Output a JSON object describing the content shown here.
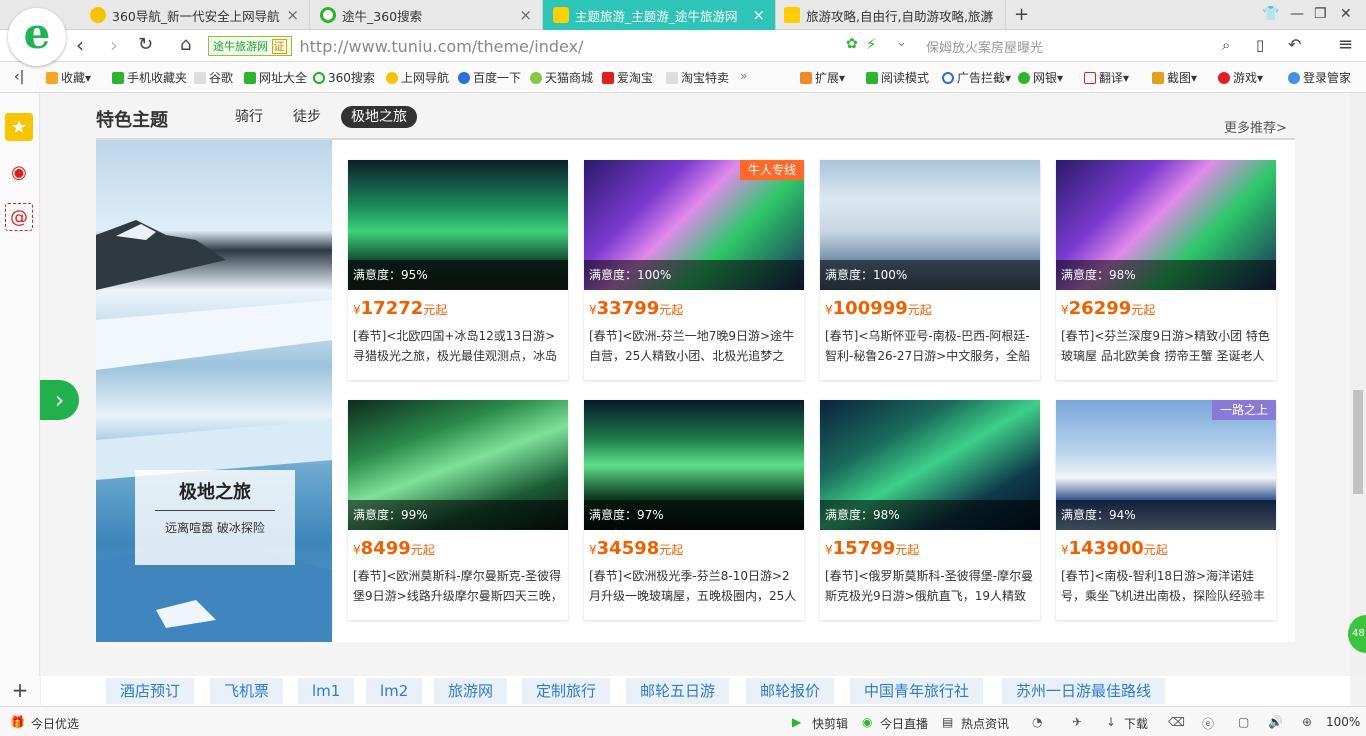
{
  "browser": {
    "tabs": [
      {
        "label": "360导航_新一代安全上网导航",
        "close": "×"
      },
      {
        "label": "途牛_360搜索",
        "close": "×"
      },
      {
        "label": "主题旅游_主题游_途牛旅游网",
        "close": "×"
      },
      {
        "label": "旅游攻略,自由行,自助游攻略,旅游",
        "close": "×"
      }
    ],
    "new_tab": "+",
    "site_badge": "途牛旅游网",
    "site_badge_verified": "证",
    "url": "http://www.tuniu.com/theme/index/",
    "search_placeholder": "保姆放火案房屋曝光",
    "logo_letter": "e"
  },
  "bookmarks": [
    {
      "label": "收藏",
      "color": "#f5a623"
    },
    {
      "label": "手机收藏夹",
      "color": "#2db52d"
    },
    {
      "label": "谷歌",
      "color": "#999999"
    },
    {
      "label": "网址大全",
      "color": "#2db52d"
    },
    {
      "label": "360搜索",
      "color": "#1bb21b"
    },
    {
      "label": "上网导航",
      "color": "#1bb21b"
    },
    {
      "label": "百度一下",
      "color": "#2b6de0"
    },
    {
      "label": "天猫商城",
      "color": "#8cc63f"
    },
    {
      "label": "爱淘宝",
      "color": "#e02020"
    },
    {
      "label": "淘宝特卖",
      "color": "#999999"
    }
  ],
  "bookmarks_more": "»",
  "toolbar_right": [
    {
      "label": "扩展"
    },
    {
      "label": "阅读模式"
    },
    {
      "label": "广告拦截"
    },
    {
      "label": "网银"
    },
    {
      "label": "翻译"
    },
    {
      "label": "截图"
    },
    {
      "label": "游戏"
    },
    {
      "label": "登录管家"
    }
  ],
  "section": {
    "title": "特色主题",
    "tabs": [
      "骑行",
      "徒步",
      "极地之旅"
    ],
    "active_tab": "极地之旅",
    "more": "更多推荐>"
  },
  "banner": {
    "title": "极地之旅",
    "subtitle": "远离喧嚣 破冰探险"
  },
  "products": [
    {
      "satisfaction": "满意度：95%",
      "currency": "¥",
      "price": "17272",
      "suffix": "元起",
      "desc": "[春节]<北欧四国+冰岛12或13日游>寻猎极光之旅，极光最佳观测点，冰岛双",
      "tag": ""
    },
    {
      "satisfaction": "满意度：100%",
      "currency": "¥",
      "price": "33799",
      "suffix": "元起",
      "desc": "[春节]<欧洲-芬兰一地7晚9日游>途牛自营，25人精致小团、北极光追梦之",
      "tag": "牛人专线"
    },
    {
      "satisfaction": "满意度：100%",
      "currency": "¥",
      "price": "100999",
      "suffix": "元起",
      "desc": "[春节]<乌斯怀亚号-南极-巴西-阿根廷-智利-秘鲁26-27日游>中文服务，全船",
      "tag": ""
    },
    {
      "satisfaction": "满意度：98%",
      "currency": "¥",
      "price": "26299",
      "suffix": "元起",
      "desc": "[春节]<芬兰深度9日游>精致小团 特色玻璃屋 品北欧美食 捞帝王蟹 圣诞老人",
      "tag": ""
    },
    {
      "satisfaction": "满意度：99%",
      "currency": "¥",
      "price": "8499",
      "suffix": "元起",
      "desc": "[春节]<欧洲莫斯科-摩尔曼斯克-圣彼得堡9日游>线路升级摩尔曼斯四天三晚，",
      "tag": ""
    },
    {
      "satisfaction": "满意度：97%",
      "currency": "¥",
      "price": "34598",
      "suffix": "元起",
      "desc": "[春节]<欧洲极光季-芬兰8-10日游>2月升级一晚玻璃屋，五晚极圈内，25人小",
      "tag": ""
    },
    {
      "satisfaction": "满意度：98%",
      "currency": "¥",
      "price": "15799",
      "suffix": "元起",
      "desc": "[春节]<俄罗斯莫斯科-圣彼得堡-摩尔曼斯克极光9日游>俄航直飞，19人精致小",
      "tag": ""
    },
    {
      "satisfaction": "满意度：94%",
      "currency": "¥",
      "price": "143900",
      "suffix": "元起",
      "desc": "[春节]<南极-智利18日游>海洋诺娃号，乘坐飞机进出南极，探险队经验丰",
      "tag": "一路之上"
    }
  ],
  "footer_links": [
    "酒店预订",
    "飞机票",
    "lm1",
    "lm2",
    "旅游网",
    "定制旅行",
    "邮轮五日游",
    "邮轮报价",
    "中国青年旅行社",
    "苏州一日游最佳路线"
  ],
  "statusbar": {
    "left": "今日优选",
    "items": [
      "快剪辑",
      "今日直播",
      "热点资讯",
      "下载"
    ],
    "zoom": "100%"
  },
  "float_badge": "48"
}
